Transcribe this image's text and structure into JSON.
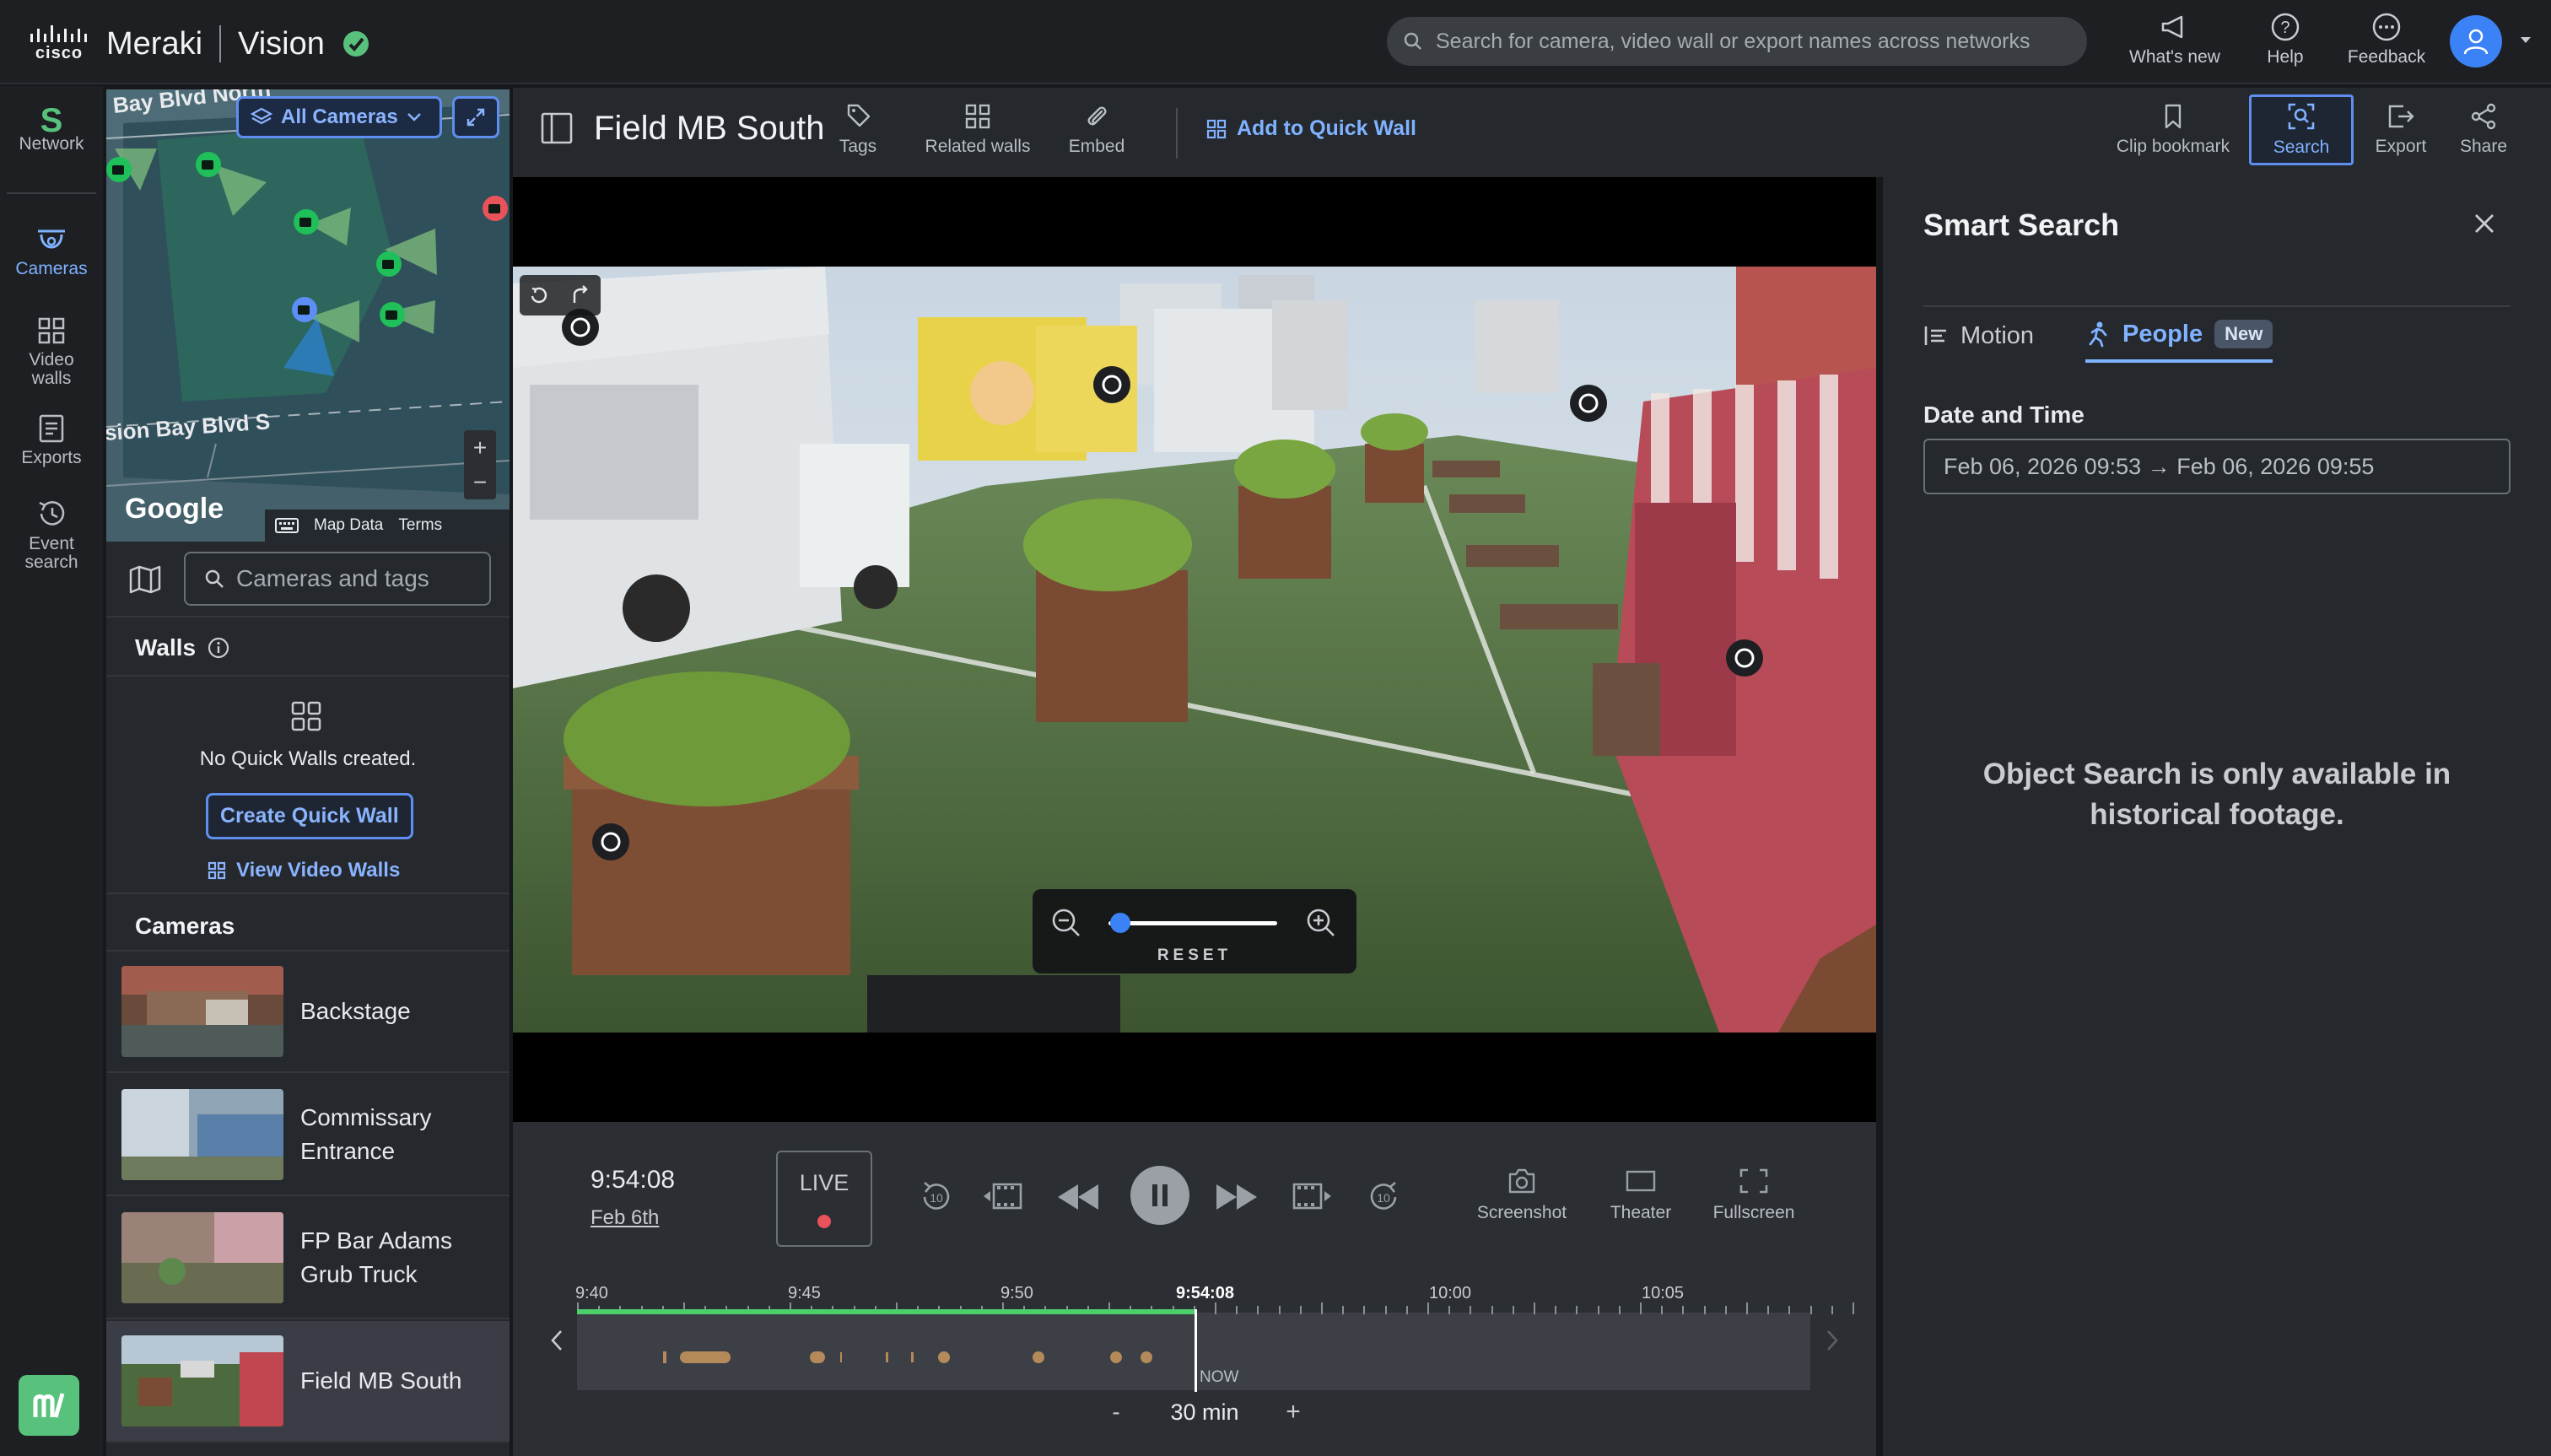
{
  "topbar": {
    "brand_cisco": "cisco",
    "brand_meraki": "Meraki",
    "brand_vision": "Vision",
    "search_placeholder": "Search for camera, video wall or export names across networks",
    "whats_new": "What's new",
    "help": "Help",
    "feedback": "Feedback"
  },
  "nav": {
    "network_letter": "S",
    "network": "Network",
    "cameras": "Cameras",
    "video_walls": "Video walls",
    "exports": "Exports",
    "event_search": "Event search"
  },
  "map": {
    "street_top": "Bay Blvd North",
    "street_bottom": "sion Bay Blvd S",
    "filter": "All Cameras",
    "google": "Google",
    "map_data": "Map Data",
    "terms": "Terms",
    "zoom_in": "+",
    "zoom_out": "−"
  },
  "camera_search": {
    "placeholder": "Cameras and tags"
  },
  "walls": {
    "title": "Walls",
    "empty": "No Quick Walls created.",
    "create": "Create Quick Wall",
    "view": "View Video Walls"
  },
  "cameras": {
    "title": "Cameras",
    "items": [
      {
        "name": "Backstage"
      },
      {
        "name": "Commissary Entrance"
      },
      {
        "name": "FP Bar Adams Grub Truck"
      },
      {
        "name": "Field MB South"
      }
    ]
  },
  "video_header": {
    "title": "Field MB South",
    "tags": "Tags",
    "related_walls": "Related walls",
    "embed": "Embed",
    "add_quick_wall": "Add to Quick Wall",
    "clip_bookmark": "Clip bookmark",
    "search": "Search",
    "export": "Export",
    "share": "Share"
  },
  "zoom": {
    "reset": "RESET",
    "level": 0.0
  },
  "playback": {
    "time": "9:54:08",
    "date": "Feb 6th",
    "live": "LIVE",
    "skip_back": "10",
    "skip_forward": "10",
    "screenshot": "Screenshot",
    "theater": "Theater",
    "fullscreen": "Fullscreen",
    "timeline_labels": [
      "9:40",
      "9:45",
      "9:50",
      "9:54:08",
      "10:00",
      "10:05"
    ],
    "now_label": "NOW",
    "zoom_minus": "-",
    "window": "30 min",
    "zoom_plus": "+"
  },
  "smart_search": {
    "title": "Smart Search",
    "tab_motion": "Motion",
    "tab_people": "People",
    "new_badge": "New",
    "date_label": "Date and Time",
    "date_range": "Feb 06, 2026 09:53 → Feb 06, 2026 09:55",
    "message": "Object Search is only available in historical footage."
  },
  "colors": {
    "accent": "#7fb2ff",
    "meraki_green": "#58c27d",
    "live_dot": "#e8525b",
    "timeline_progress": "#4ccf6a",
    "event_marker": "#b48a5a"
  }
}
